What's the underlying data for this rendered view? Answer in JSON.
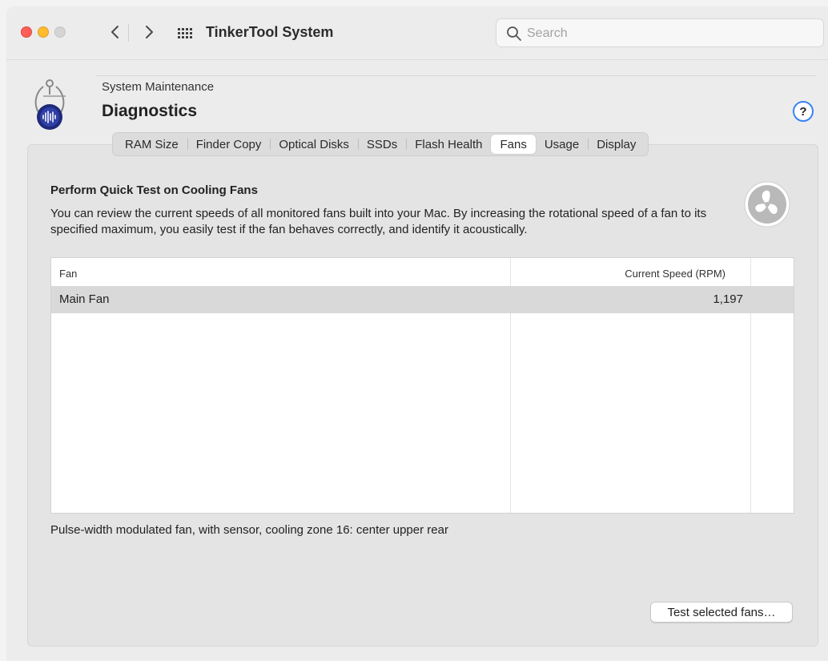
{
  "window": {
    "app_title": "TinkerTool System",
    "search": {
      "placeholder": "Search",
      "value": ""
    },
    "icons": {
      "close": "close-traffic-light-icon",
      "minimize": "minimize-traffic-light-icon",
      "zoom": "zoom-traffic-light-icon",
      "back": "chevron-left-icon",
      "forward": "chevron-right-icon",
      "grid": "grid-icon",
      "search": "magnifying-glass-icon"
    }
  },
  "header": {
    "breadcrumb": "System Maintenance",
    "title": "Diagnostics",
    "help_label": "?"
  },
  "tabs": [
    {
      "label": "RAM Size",
      "active": false
    },
    {
      "label": "Finder Copy",
      "active": false
    },
    {
      "label": "Optical Disks",
      "active": false
    },
    {
      "label": "SSDs",
      "active": false
    },
    {
      "label": "Flash Health",
      "active": false
    },
    {
      "label": "Fans",
      "active": true
    },
    {
      "label": "Usage",
      "active": false
    },
    {
      "label": "Display",
      "active": false
    }
  ],
  "main": {
    "section_title": "Perform Quick Test on Cooling Fans",
    "description": "You can review the current speeds of all monitored fans built into your Mac. By increasing the rotational speed of a fan to its specified maximum, you easily test if the fan behaves correctly, and identify it acoustically.",
    "table": {
      "columns": [
        "Fan",
        "Current Speed (RPM)"
      ],
      "rows": [
        {
          "fan": "Main Fan",
          "speed": "1,197",
          "selected": true
        }
      ]
    },
    "fan_info": "Pulse-width modulated fan, with sensor, cooling zone 16: center upper rear",
    "test_button": "Test selected fans…"
  },
  "colors": {
    "accent": "#3b82f6",
    "close": "#ff5f57",
    "minimize": "#febc2e",
    "zoom_inactive": "#d4d4d4",
    "selected_row": "#d9d9d9"
  }
}
